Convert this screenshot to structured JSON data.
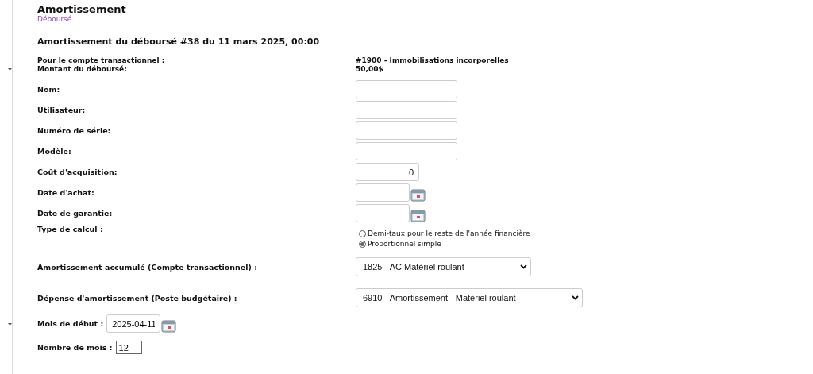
{
  "header": {
    "title": "Amortissement",
    "subtitle": "Déboursé"
  },
  "heading": "Amortissement du déboursé #38 du 11 mars 2025, 00:00",
  "summary": [
    {
      "label": "Pour le compte transactionnel :",
      "value": "#1900 - Immobilisations incorporelles"
    },
    {
      "label": "Montant du déboursé:",
      "value": "50,00$"
    }
  ],
  "fields": [
    {
      "kind": "text",
      "label": "Nom:"
    },
    {
      "kind": "text",
      "label": "Utilisateur:"
    },
    {
      "kind": "text",
      "label": "Numéro de série:"
    },
    {
      "kind": "text",
      "label": "Modèle:"
    },
    {
      "kind": "amount",
      "label": "Coût d'acquisition:",
      "value": "0"
    },
    {
      "kind": "date",
      "label": "Date d'achat:"
    },
    {
      "kind": "date",
      "label": "Date de garantie:"
    },
    {
      "kind": "radio",
      "label": "Type de calcul :",
      "options": [
        {
          "label": "Demi-taux pour le reste de l'année financière",
          "selected": false
        },
        {
          "label": "Proportionnel simple",
          "selected": true
        }
      ]
    },
    {
      "kind": "select",
      "label": "Amortissement accumulé (Compte transactionnel) :",
      "value": "1825 - AC Matériel roulant"
    },
    {
      "kind": "select",
      "label": "Dépense d'amortissement (Poste budgétaire) :",
      "value": "6910 - Amortissement - Matériel roulant"
    }
  ],
  "inline_fields": [
    {
      "kind": "date",
      "label": "Mois de début :",
      "value": "2025-04-11"
    },
    {
      "kind": "short",
      "label": "Nombre de mois :",
      "value": "12"
    }
  ]
}
